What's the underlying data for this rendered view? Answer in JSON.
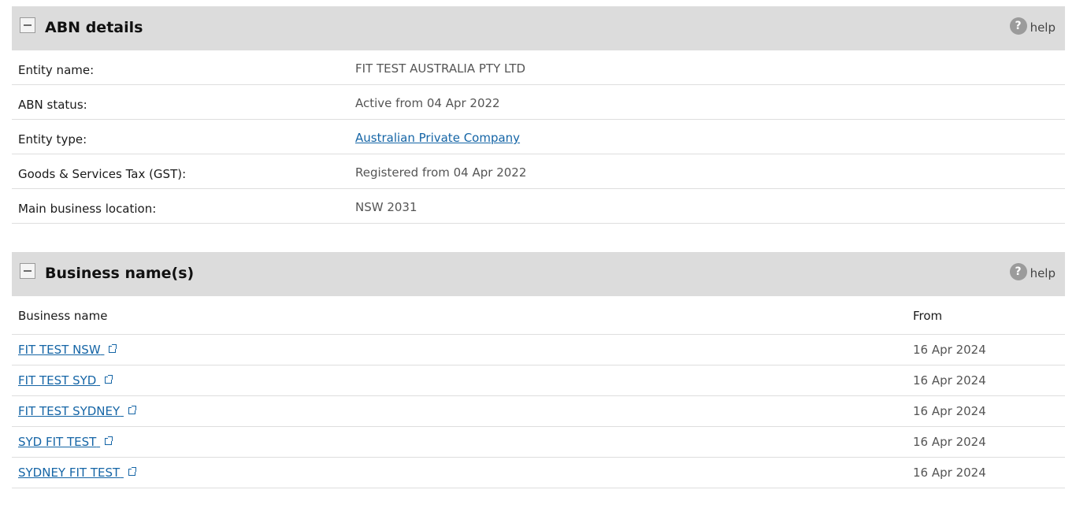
{
  "abn_details": {
    "title": "ABN details",
    "help_label": "help",
    "rows": [
      {
        "label": "Entity name:",
        "value": "FIT TEST AUSTRALIA PTY LTD"
      },
      {
        "label": "ABN status:",
        "value": "Active from 04 Apr 2022"
      },
      {
        "label": "Entity type:",
        "value": "Australian Private Company"
      },
      {
        "label": "Goods & Services Tax (GST):",
        "value": "Registered from 04 Apr 2022"
      },
      {
        "label": "Main business location:",
        "value": "NSW 2031"
      }
    ]
  },
  "business_names": {
    "title": "Business name(s)",
    "help_label": "help",
    "columns": [
      "Business name",
      "From"
    ],
    "rows": [
      {
        "name": "FIT TEST NSW",
        "from": "16 Apr 2024"
      },
      {
        "name": "FIT TEST SYD",
        "from": "16 Apr 2024"
      },
      {
        "name": "FIT TEST SYDNEY",
        "from": "16 Apr 2024"
      },
      {
        "name": "SYD FIT TEST",
        "from": "16 Apr 2024"
      },
      {
        "name": "SYDNEY FIT TEST",
        "from": "16 Apr 2024"
      }
    ]
  },
  "icons": {
    "help": "question-circle-icon",
    "collapse": "minus-square-icon",
    "external_link": "external-link-icon"
  },
  "colors": {
    "header_bg": "#dcdcdc",
    "link": "#1565a6"
  }
}
